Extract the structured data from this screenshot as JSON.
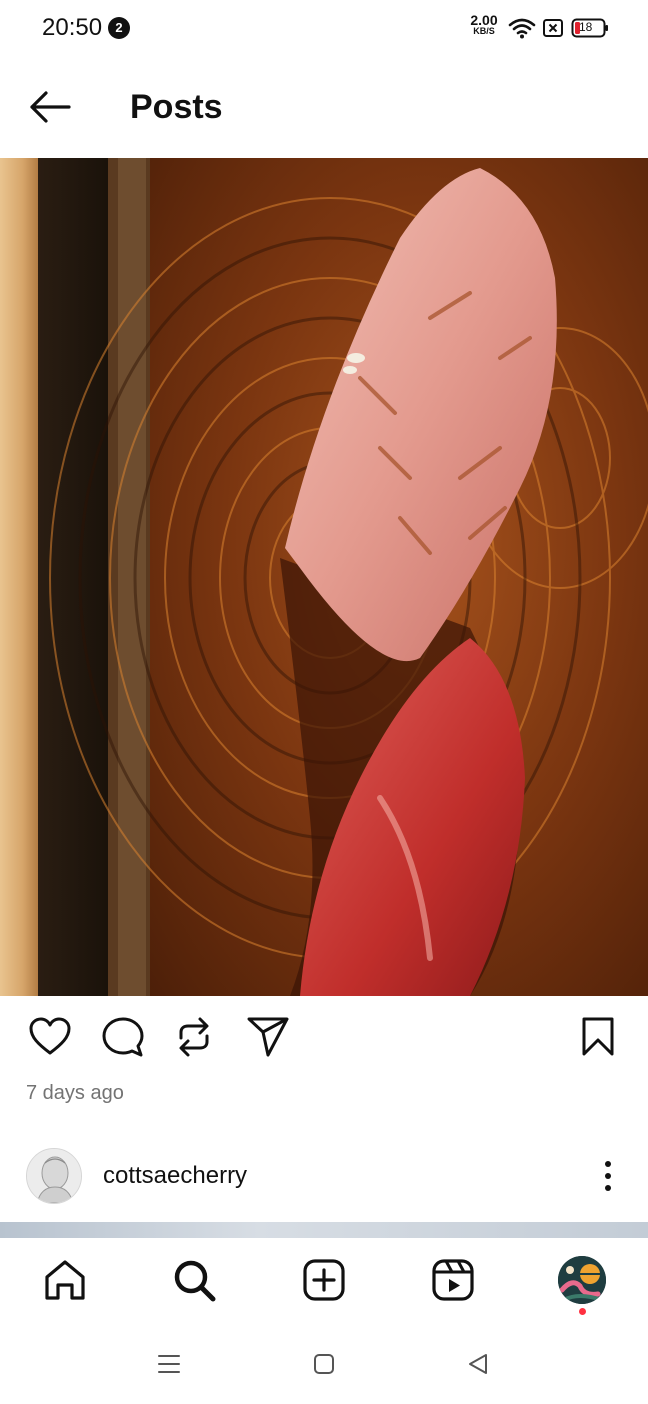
{
  "status_bar": {
    "time": "20:50",
    "notification_count": "2",
    "net_speed_value": "2.00",
    "net_speed_unit": "KB/S",
    "battery_level": "18"
  },
  "header": {
    "title": "Posts"
  },
  "post": {
    "timestamp": "7 days ago"
  },
  "next_post": {
    "username": "cottsaecherry"
  },
  "colors": {
    "icon": "#111111",
    "timestamp": "#737373",
    "badge_red": "#ff3040"
  },
  "icons": {
    "header": [
      "back-arrow-icon"
    ],
    "actions": [
      "heart-icon",
      "comment-icon",
      "repost-icon",
      "share-icon",
      "bookmark-icon"
    ],
    "tabbar": [
      "home-icon",
      "search-icon",
      "create-icon",
      "reels-icon",
      "profile-avatar"
    ],
    "system_nav": [
      "menu-icon",
      "home-square-icon",
      "back-triangle-icon"
    ]
  }
}
